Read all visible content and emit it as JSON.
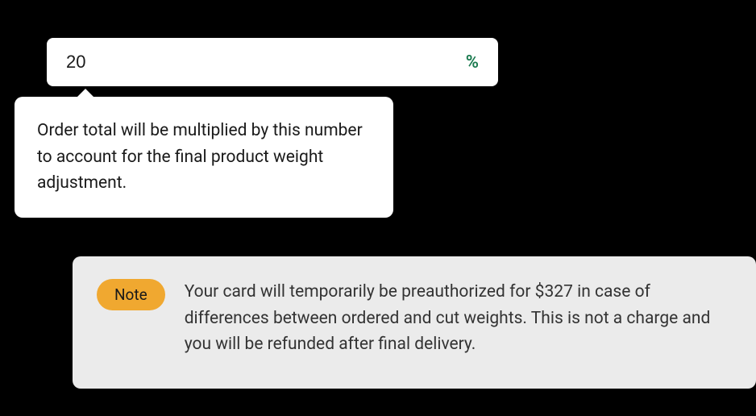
{
  "input": {
    "value": "20",
    "suffix": "%"
  },
  "tooltip": {
    "text": "Order total will be multiplied by this number to account for the final product weight adjustment."
  },
  "note": {
    "badge": "Note",
    "text": "Your card will temporarily be preauthorized for $327 in case of differences between ordered and cut weights. This is not a charge and you will be refunded after final delivery."
  }
}
